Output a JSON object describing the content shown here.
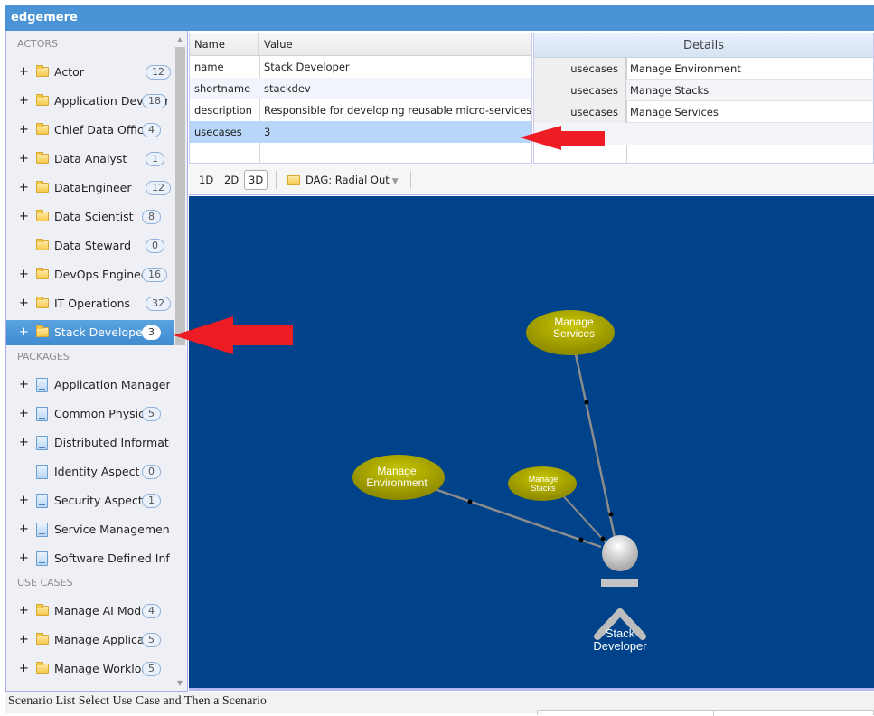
{
  "app": {
    "title": "edgemere"
  },
  "sidebar": {
    "sections": [
      {
        "heading": "ACTORS",
        "items": [
          {
            "label": "Actor",
            "count": "12",
            "expandable": true,
            "icon": "folder-icon"
          },
          {
            "label": "Application Deve",
            "count": "18",
            "expandable": true,
            "icon": "folder-icon",
            "overflow": "r"
          },
          {
            "label": "Chief Data Office",
            "count": "4",
            "expandable": true,
            "icon": "folder-icon"
          },
          {
            "label": "Data Analyst",
            "count": "1",
            "expandable": true,
            "icon": "folder-icon"
          },
          {
            "label": "DataEngineer",
            "count": "12",
            "expandable": true,
            "icon": "folder-icon"
          },
          {
            "label": "Data Scientist",
            "count": "8",
            "expandable": true,
            "icon": "folder-icon"
          },
          {
            "label": "Data Steward",
            "count": "0",
            "expandable": false,
            "icon": "folder-icon"
          },
          {
            "label": "DevOps Enginee",
            "count": "16",
            "expandable": true,
            "icon": "folder-icon"
          },
          {
            "label": "IT Operations",
            "count": "32",
            "expandable": true,
            "icon": "folder-icon"
          },
          {
            "label": "Stack Developer",
            "count": "3",
            "expandable": true,
            "icon": "folder-icon",
            "selected": true
          }
        ]
      },
      {
        "heading": "PACKAGES",
        "items": [
          {
            "label": "Application Management",
            "count": "",
            "expandable": true,
            "icon": "package-icon"
          },
          {
            "label": "Common Physical L",
            "count": "5",
            "expandable": true,
            "icon": "package-icon"
          },
          {
            "label": "Distributed Information",
            "count": "",
            "expandable": true,
            "icon": "package-icon"
          },
          {
            "label": "Identity Aspect",
            "count": "0",
            "expandable": false,
            "icon": "package-icon"
          },
          {
            "label": "Security Aspect",
            "count": "1",
            "expandable": true,
            "icon": "package-icon"
          },
          {
            "label": "Service Management",
            "count": "",
            "expandable": true,
            "icon": "package-icon"
          },
          {
            "label": "Software Defined Infr",
            "count": "",
            "expandable": true,
            "icon": "package-icon"
          }
        ]
      },
      {
        "heading": "USE CASES",
        "items": [
          {
            "label": "Manage AI Model",
            "count": "4",
            "expandable": true,
            "icon": "folder-icon"
          },
          {
            "label": "Manage Applicati",
            "count": "5",
            "expandable": true,
            "icon": "folder-icon"
          },
          {
            "label": "Manage Workload",
            "count": "5",
            "expandable": true,
            "icon": "folder-icon"
          }
        ]
      }
    ]
  },
  "properties": {
    "columns": [
      "Name",
      "Value"
    ],
    "rows": [
      {
        "name": "name",
        "value": "Stack Developer"
      },
      {
        "name": "shortname",
        "value": "stackdev"
      },
      {
        "name": "description",
        "value": "Responsible for developing reusable micro-services..."
      },
      {
        "name": "usecases",
        "value": "3",
        "selected": true
      }
    ]
  },
  "details": {
    "title": "Details",
    "rows": [
      {
        "key": "usecases",
        "value": "Manage Environment"
      },
      {
        "key": "usecases",
        "value": "Manage Stacks"
      },
      {
        "key": "usecases",
        "value": "Manage Services"
      }
    ]
  },
  "toolbar": {
    "view_buttons": [
      "1D",
      "2D",
      "3D"
    ],
    "active_view": "3D",
    "layout_dropdown": "DAG: Radial Out"
  },
  "graph": {
    "actor": {
      "label_line1": "Stack",
      "label_line2": "Developer"
    },
    "usecases": [
      {
        "line1": "Manage",
        "line2": "Services"
      },
      {
        "line1": "Manage",
        "line2": "Environment"
      },
      {
        "line1": "Manage",
        "line2": "Stacks"
      }
    ],
    "colors": {
      "background": "#00438a",
      "node": "#9c9a00",
      "edge": "#8c8c8c"
    }
  },
  "status": {
    "text": "Scenario List Select Use Case and Then a Scenario"
  }
}
